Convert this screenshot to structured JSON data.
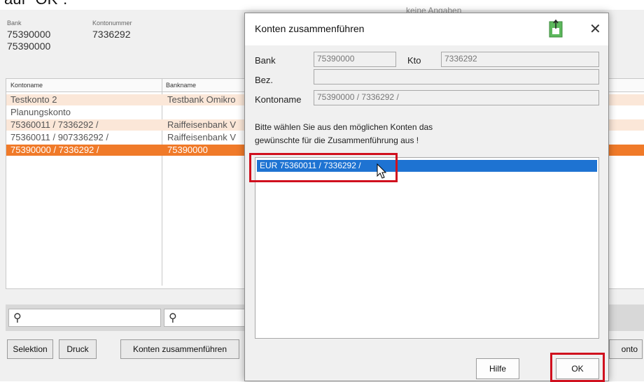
{
  "caption": "auf \"OK\".",
  "background": {
    "bank_label": "Bank",
    "account_number_label": "Kontonummer",
    "bank_value_1": "75390000",
    "account_value": "7336292",
    "bank_value_2": "75390000",
    "top_right_text": "keine Angaben",
    "columns": [
      "Kontoname",
      "Bankname"
    ],
    "rows": [
      {
        "name": "Testkonto 2",
        "bank": "Testbank Omikro",
        "style": "light"
      },
      {
        "name": "Planungskonto",
        "bank": "",
        "style": "plain"
      },
      {
        "name": "75360011 / 7336292 /",
        "bank": "Raiffeisenbank V",
        "style": "light"
      },
      {
        "name": "75360011 / 907336292 /",
        "bank": "Raiffeisenbank V",
        "style": "plain"
      },
      {
        "name": "75390000 / 7336292 /",
        "bank": "75390000",
        "style": "selected"
      }
    ],
    "buttons": {
      "selection": "Selektion",
      "print": "Druck",
      "merge": "Konten zusammenführen",
      "konto_partial": "onto"
    }
  },
  "dialog": {
    "title": "Konten zusammenführen",
    "bank_label": "Bank",
    "bank_value": "75390000",
    "kto_label": "Kto",
    "kto_value": "7336292",
    "bez_label": "Bez.",
    "bez_value": "",
    "kontoname_label": "Kontoname",
    "kontoname_value": "75390000 / 7336292 /",
    "instruction_line1": "Bitte wählen Sie aus den möglichen Konten das",
    "instruction_line2": "gewünschte für die Zusammenführung aus !",
    "list_items": [
      "EUR  75360011 / 7336292 /"
    ],
    "help_button": "Hilfe",
    "ok_button": "OK"
  },
  "colors": {
    "selected_row": "#f07a29",
    "light_row": "#fbe7d8",
    "list_selection": "#1e73d2",
    "highlight_red": "#d0101e"
  },
  "icons": [
    "search-icon",
    "search-icon",
    "green-app-icon",
    "close-icon",
    "mouse-cursor-icon"
  ]
}
